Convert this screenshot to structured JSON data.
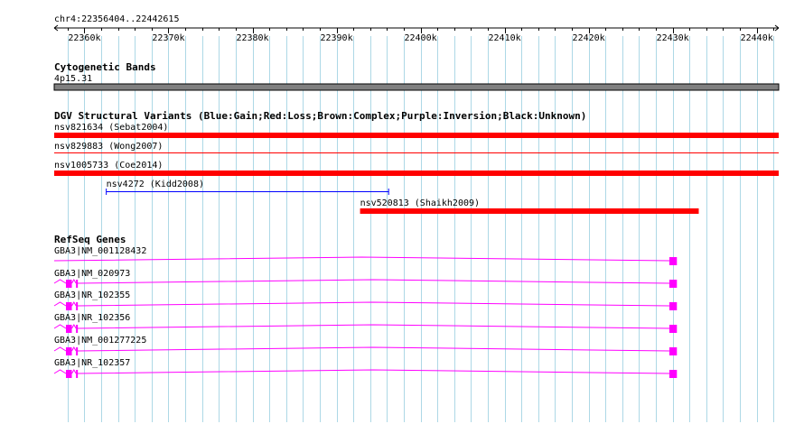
{
  "region": "chr4:22356404..22442615",
  "range": {
    "start": 22356404,
    "end": 22442615
  },
  "ruler": {
    "ticks": [
      22360000,
      22370000,
      22380000,
      22390000,
      22400000,
      22410000,
      22420000,
      22430000,
      22440000
    ],
    "tick_labels": [
      "22360k",
      "22370k",
      "22380k",
      "22390k",
      "22400k",
      "22410k",
      "22420k",
      "22430k",
      "22440k"
    ]
  },
  "cytoband": {
    "title": "Cytogenetic Bands",
    "band_label": "4p15.31",
    "color": "#808080"
  },
  "dgv": {
    "title": "DGV Structural Variants (Blue:Gain;Red:Loss;Brown:Complex;Purple:Inversion;Black:Unknown)",
    "colors": {
      "gain": "#0000ff",
      "loss": "#ff0000",
      "complex": "#a52a2a",
      "inversion": "#800080",
      "unknown": "#000000"
    },
    "variants": [
      {
        "label": "nsv821634 (Sebat2004)",
        "start": 22356404,
        "end": 22442615,
        "type": "loss",
        "style": "thick"
      },
      {
        "label": "nsv829883 (Wong2007)",
        "start": 22356404,
        "end": 22442615,
        "type": "loss",
        "style": "thin"
      },
      {
        "label": "nsv1005733 (Coe2014)",
        "start": 22356404,
        "end": 22442615,
        "type": "loss",
        "style": "thick"
      },
      {
        "label": "nsv4272 (Kidd2008)",
        "start": 22362600,
        "end": 22396200,
        "type": "gain",
        "style": "interval"
      },
      {
        "label": "nsv520813 (Shaikh2009)",
        "start": 22392800,
        "end": 22433100,
        "type": "loss",
        "style": "thick"
      }
    ]
  },
  "refseq": {
    "title": "RefSeq Genes",
    "color": "#ff00ff",
    "transcripts": [
      {
        "label": "GBA3|NM_001128432",
        "start": 22356404,
        "end": 22430500,
        "exons": [
          [
            22429600,
            22430500
          ]
        ]
      },
      {
        "label": "GBA3|NM_020973",
        "start": 22356404,
        "end": 22430500,
        "exons": [
          [
            22357800,
            22358500
          ],
          [
            22359000,
            22359150
          ],
          [
            22429600,
            22430500
          ]
        ]
      },
      {
        "label": "GBA3|NR_102355",
        "start": 22356404,
        "end": 22430500,
        "exons": [
          [
            22357800,
            22358500
          ],
          [
            22359000,
            22359150
          ],
          [
            22429600,
            22430500
          ]
        ]
      },
      {
        "label": "GBA3|NR_102356",
        "start": 22356404,
        "end": 22430500,
        "exons": [
          [
            22357800,
            22358500
          ],
          [
            22359000,
            22359150
          ],
          [
            22429600,
            22430500
          ]
        ]
      },
      {
        "label": "GBA3|NM_001277225",
        "start": 22356404,
        "end": 22430500,
        "exons": [
          [
            22357800,
            22358500
          ],
          [
            22359000,
            22359150
          ],
          [
            22429600,
            22430500
          ]
        ]
      },
      {
        "label": "GBA3|NR_102357",
        "start": 22356404,
        "end": 22430500,
        "exons": [
          [
            22357800,
            22358500
          ],
          [
            22359000,
            22359150
          ],
          [
            22429600,
            22430500
          ]
        ]
      }
    ]
  },
  "grid_color": "#add8e6"
}
